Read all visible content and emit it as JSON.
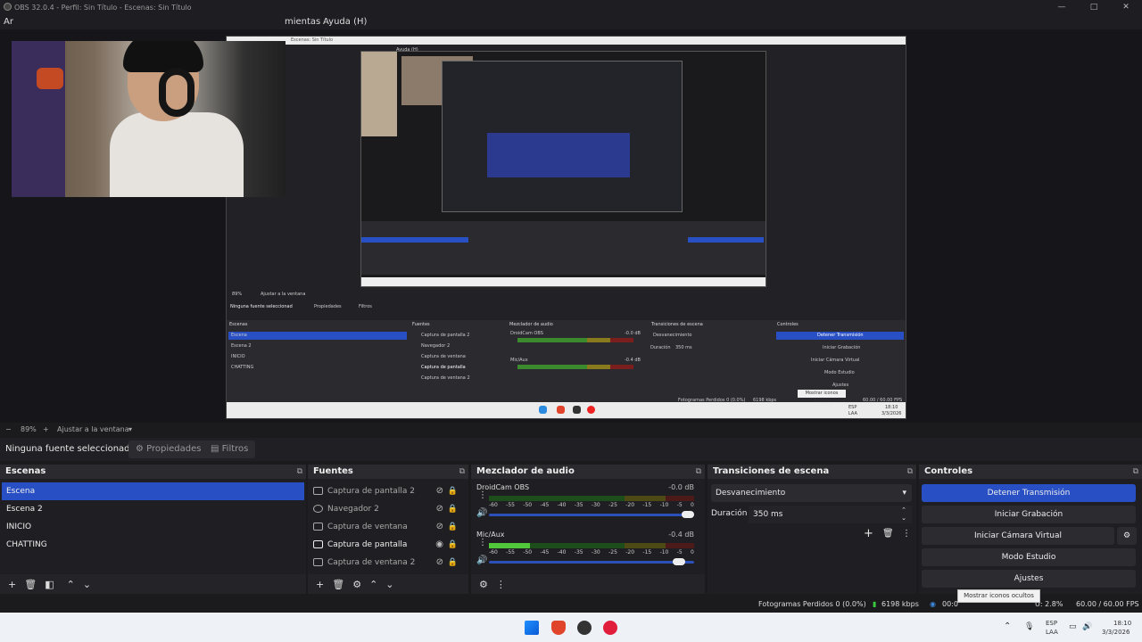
{
  "window": {
    "title": "OBS 32.0.4 - Perfil: Sin Título - Escenas: Sin Título",
    "min": "—",
    "max": "□",
    "close": "✕"
  },
  "menu": {
    "items": [
      "Archivo",
      "Herramientas",
      "Ayuda (H)"
    ],
    "visible_partial_left": "Ar",
    "visible_partial_mid": "mientas",
    "help": "Ayuda (H)"
  },
  "preview": {
    "zoom": "89%",
    "zoom_minus": "−",
    "zoom_plus": "+",
    "fit": "Ajustar a la ventana"
  },
  "capture": {
    "title": "Escenas: Sin Título",
    "menu_help": "Ayuda (H)",
    "nosel": "Ninguna fuente seleccionad",
    "props": "Propiedades",
    "filters": "Filtros",
    "zoom": "89%",
    "fit": "Ajustar a la ventana",
    "panels": {
      "scenes": "Escenas",
      "sources": "Fuentes",
      "mixer": "Mezclador de audio",
      "transitions": "Transiciones de escena",
      "controls": "Controles"
    },
    "scenes": [
      "Escena",
      "Escena 2",
      "INICIO",
      "CHATTING"
    ],
    "sources": [
      "Captura de pantalla 2",
      "Navegador 2",
      "Captura de ventana",
      "Captura de pantalla",
      "Captura de ventana 2"
    ],
    "mixer": [
      {
        "name": "DroidCam OBS",
        "db": "-0.0 dB"
      },
      {
        "name": "Mic/Aux",
        "db": "-0.4 dB"
      }
    ],
    "transition": "Desvanecimiento",
    "duration_label": "Duración",
    "duration": "350 ms",
    "controls": [
      "Detener Transmisión",
      "Iniciar Grabación",
      "Iniciar Cámara Virtual",
      "Modo Estudio",
      "Ajustes"
    ],
    "status": "Fotogramas Perdidos 0 (0.0%)",
    "kbps": "6198 kbps",
    "fps": "60.00 / 60.00 FPS",
    "tooltip": "Mostrar iconos ocultos",
    "lang": "ESP",
    "lang2": "LAA",
    "time": "18:10",
    "date": "3/3/2026"
  },
  "source_bar": {
    "no_selection": "Ninguna fuente seleccionad",
    "properties": "Propiedades",
    "filters": "Filtros"
  },
  "scenes": {
    "title": "Escenas",
    "items": [
      "Escena",
      "Escena 2",
      "INICIO",
      "CHATTING"
    ],
    "active_index": 0
  },
  "sources": {
    "title": "Fuentes",
    "items": [
      {
        "label": "Captura de pantalla 2",
        "icon": "monitor-icon",
        "visible": false
      },
      {
        "label": "Navegador 2",
        "icon": "globe-icon",
        "visible": false
      },
      {
        "label": "Captura de ventana",
        "icon": "window-icon",
        "visible": false
      },
      {
        "label": "Captura de pantalla",
        "icon": "monitor-icon",
        "visible": true
      },
      {
        "label": "Captura de ventana 2",
        "icon": "window-icon",
        "visible": false
      }
    ]
  },
  "mixer": {
    "title": "Mezclador de audio",
    "channels": [
      {
        "name": "DroidCam OBS",
        "db": "-0.0 dB",
        "level": 0,
        "volume": 1.0
      },
      {
        "name": "Mic/Aux",
        "db": "-0.4 dB",
        "level": 0.2,
        "volume": 0.96
      }
    ],
    "ticks": [
      "-60",
      "-55",
      "-50",
      "-45",
      "-40",
      "-35",
      "-30",
      "-25",
      "-20",
      "-15",
      "-10",
      "-5",
      "0"
    ]
  },
  "transitions": {
    "title": "Transiciones de escena",
    "selected": "Desvanecimiento",
    "duration_label": "Duración",
    "duration": "350 ms"
  },
  "controls": {
    "title": "Controles",
    "stop_stream": "Detener Transmisión",
    "start_recording": "Iniciar Grabación",
    "start_virtual_cam": "Iniciar Cámara Virtual",
    "studio_mode": "Modo Estudio",
    "settings": "Ajustes"
  },
  "status": {
    "dropped": "Fotogramas Perdidos 0 (0.0%)",
    "kbps": "6198 kbps",
    "time": "00:0",
    "cpu": "U: 2.8%",
    "fps": "60.00 / 60.00 FPS"
  },
  "tooltip": "Mostrar iconos ocultos",
  "taskbar": {
    "lang": "ESP",
    "lang2": "LAA",
    "time": "18:10",
    "date": "3/3/2026"
  },
  "colors": {
    "accent": "#284fc4",
    "bg": "#1b1b1e",
    "panel": "#1f1f23",
    "header": "#2a2a2f"
  }
}
